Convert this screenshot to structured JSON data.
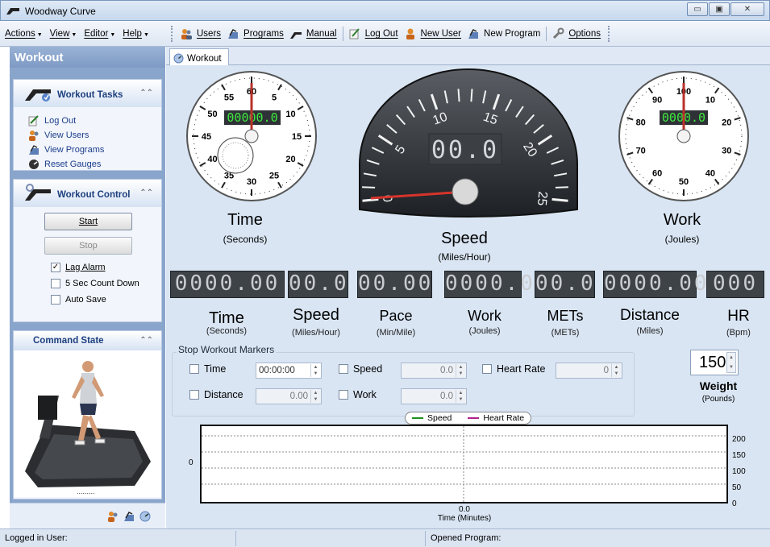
{
  "window": {
    "title": "Woodway Curve",
    "minimize": "▭",
    "maximize": "▣",
    "close": "✕"
  },
  "menu": [
    {
      "label": "Actions"
    },
    {
      "label": "View"
    },
    {
      "label": "Editor"
    },
    {
      "label": "Help"
    }
  ],
  "toolbar": {
    "users": "Users",
    "programs": "Programs",
    "manual": "Manual",
    "logout": "Log Out",
    "new_user": "New User",
    "new_program": "New Program",
    "options": "Options"
  },
  "sidebar": {
    "title": "Workout",
    "tasks": {
      "title": "Workout Tasks",
      "items": [
        "Log Out",
        "View Users",
        "View Programs",
        "Reset Gauges"
      ]
    },
    "control": {
      "title": "Workout Control",
      "start": "Start",
      "stop": "Stop",
      "options": [
        {
          "label": "Lag Alarm",
          "checked": true
        },
        {
          "label": "5 Sec Count Down",
          "checked": false
        },
        {
          "label": "Auto Save",
          "checked": false
        }
      ]
    },
    "command_state": {
      "title": "Command State",
      "grip": "........."
    }
  },
  "tab": {
    "label": "Workout"
  },
  "gauges": {
    "time": {
      "title": "Time",
      "unit": "(Seconds)",
      "display": "00000.0",
      "scale": [
        "60",
        "5",
        "10",
        "15",
        "20",
        "25",
        "30",
        "35",
        "40",
        "45",
        "50",
        "55"
      ]
    },
    "speed": {
      "title": "Speed",
      "unit": "(Miles/Hour)",
      "display": "00.0",
      "scale": [
        "0",
        "5",
        "10",
        "15",
        "20",
        "25"
      ]
    },
    "work": {
      "title": "Work",
      "unit": "(Joules)",
      "display": "0000.0",
      "scale": [
        "100",
        "10",
        "20",
        "30",
        "40",
        "50",
        "60",
        "70",
        "80",
        "90"
      ]
    }
  },
  "readouts": [
    {
      "value": "0000.00",
      "title": "Time",
      "unit": "(Seconds)"
    },
    {
      "value": "00.0",
      "title": "Speed",
      "unit": "(Miles/Hour)"
    },
    {
      "value": "00.00",
      "title": "Pace",
      "unit": "(Min/Mile)"
    },
    {
      "value": "0000.0",
      "title": "Work",
      "unit": "(Joules)"
    },
    {
      "value": "00.0",
      "title": "METs",
      "unit": "(METs)"
    },
    {
      "value": "0000.00",
      "title": "Distance",
      "unit": "(Miles)"
    },
    {
      "value": "000",
      "title": "HR",
      "unit": "(Bpm)"
    }
  ],
  "stop_markers": {
    "legend": "Stop Workout Markers",
    "time": {
      "label": "Time",
      "value": "00:00:00"
    },
    "speed": {
      "label": "Speed",
      "value": "0.0"
    },
    "heart_rate": {
      "label": "Heart Rate",
      "value": "0"
    },
    "distance": {
      "label": "Distance",
      "value": "0.00"
    },
    "work": {
      "label": "Work",
      "value": "0.0"
    }
  },
  "weight": {
    "value": "150",
    "label": "Weight",
    "unit": "(Pounds)"
  },
  "chart": {
    "legend": [
      {
        "name": "Speed",
        "color": "#1a8f1a"
      },
      {
        "name": "Heart Rate",
        "color": "#b0208a"
      }
    ],
    "left_tick": "0",
    "right_ticks": [
      "200",
      "150",
      "100",
      "50",
      "0"
    ],
    "x_tick": "0.0",
    "xlabel": "Time (Minutes)"
  },
  "statusbar": {
    "user": "Logged in User:",
    "program": "Opened Program:"
  }
}
